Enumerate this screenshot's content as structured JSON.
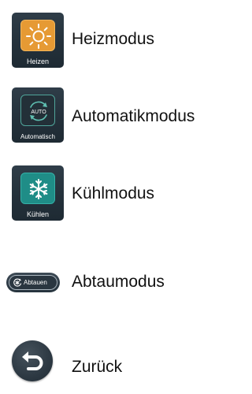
{
  "items": [
    {
      "tile_label": "Heizen",
      "description": "Heizmodus",
      "icon": "sun-icon",
      "accent": "#e69a34"
    },
    {
      "tile_label": "Automatisch",
      "description": "Automatikmodus",
      "icon": "auto-cycle-icon",
      "icon_text": "AUTO",
      "accent": "#4fa59a"
    },
    {
      "tile_label": "Kühlen",
      "description": "Kühlmodus",
      "icon": "snowflake-icon",
      "accent": "#1f8d87"
    },
    {
      "tile_label": "Abtauen",
      "description": "Abtaumodus",
      "icon": "defrost-icon"
    },
    {
      "description": "Zurück",
      "icon": "back-arrow-icon"
    }
  ]
}
